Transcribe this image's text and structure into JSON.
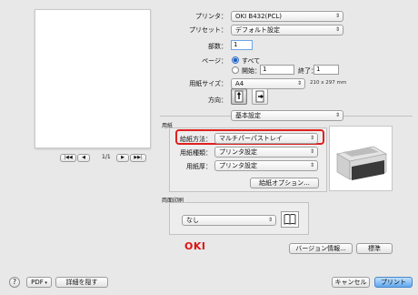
{
  "printer": {
    "label": "プリンタ：",
    "value": "OKI B432(PCL)"
  },
  "preset": {
    "label": "プリセット：",
    "value": "デフォルト設定"
  },
  "copies": {
    "label": "部数：",
    "value": "1"
  },
  "pages": {
    "label": "ページ：",
    "all": "すべて",
    "from_label": "開始：",
    "from_value": "1",
    "to_label": "終了：",
    "to_value": "1"
  },
  "paper_size": {
    "label": "用紙サイズ：",
    "value": "A4",
    "dimensions": "210 x 297 mm"
  },
  "orientation": {
    "label": "方向："
  },
  "section_popup": {
    "value": "基本設定"
  },
  "paper_group": {
    "title": "用紙",
    "feed_label": "給紙方法：",
    "feed_value": "マルチパーパストレイ",
    "type_label": "用紙種類：",
    "type_value": "プリンタ設定",
    "weight_label": "用紙厚：",
    "weight_value": "プリンタ設定",
    "options_button": "給紙オプション..."
  },
  "duplex_group": {
    "title": "両面印刷",
    "value": "なし"
  },
  "brand": {
    "logo": "OKI"
  },
  "buttons": {
    "version": "バージョン情報...",
    "standard": "標準",
    "pdf": "PDF",
    "hide_details": "詳細を隠す",
    "cancel": "キャンセル",
    "print": "プリント"
  },
  "preview_nav": {
    "page_indicator": "1/1"
  },
  "help": {
    "symbol": "?"
  },
  "colors": {
    "highlight": "#e02020",
    "default_button": "#5ea8ee"
  }
}
